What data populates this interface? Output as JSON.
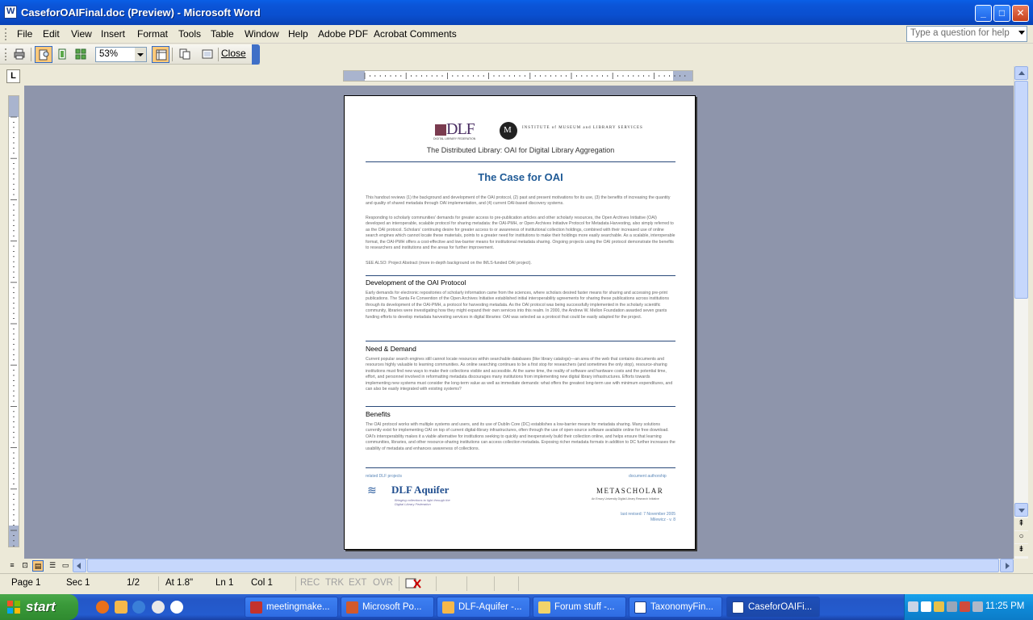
{
  "window": {
    "title": "CaseforOAIFinal.doc (Preview) - Microsoft Word"
  },
  "menu": [
    "File",
    "Edit",
    "View",
    "Insert",
    "Format",
    "Tools",
    "Table",
    "Window",
    "Help",
    "Adobe PDF",
    "Acrobat Comments"
  ],
  "help_box": {
    "placeholder": "Type a question for help"
  },
  "toolbar": {
    "zoom": "53%",
    "close_label": "Close"
  },
  "document": {
    "subtitle": "The Distributed Library: OAI for Digital Library Aggregation",
    "title": "The Case for OAI",
    "dlf_logo": "DLF",
    "dlf_logo_sub": "DIGITAL LIBRARY FEDERATION",
    "imls_logo": "INSTITUTE of MUSEUM and LIBRARY SERVICES",
    "intro1": "This handout reviews (1) the background and development of the OAI protocol, (2) past and present motivations for its use, (3) the benefits of increasing the quantity and quality of shared metadata through OAI implementation, and (4) current OAI-based discovery systems.",
    "intro2": "Responding to scholarly communities' demands for greater access to pre-publication articles and other scholarly resources, the Open Archives Initiative (OAI) developed an interoperable, scalable protocol for sharing metadata: the OAI-PMH, or Open Archives Initiative Protocol for Metadata Harvesting, also simply referred to as the OAI protocol. Scholars' continuing desire for greater access to or awareness of institutional collection holdings, combined with their increased use of online search engines which cannot locate these materials, points to a greater need for institutions to make their holdings more easily searchable. As a scalable, interoperable format, the OAI-PMH offers a cost-effective and low-barrier means for institutional metadata sharing. Ongoing projects using the OAI protocol demonstrate the benefits to researchers and institutions and the areas for further improvement.",
    "see_also": "SEE ALSO: Project Abstract (more in-depth background on the IMLS-funded OAI project).",
    "sections": [
      {
        "heading": "Development of the OAI Protocol",
        "text": "Early demands for electronic repositories of scholarly information came from the sciences, where scholars desired faster means for sharing and accessing pre-print publications. The Santa Fe Convention of the Open Archives Initiative established initial interoperability agreements for sharing these publications across institutions through its development of the OAI-PMH, a protocol for harvesting metadata. As the OAI protocol was being successfully implemented in the scholarly scientific community, libraries were investigating how they might expand their own services into this realm. In 2000, the Andrew W. Mellon Foundation awarded seven grants funding efforts to develop metadata harvesting services in digital libraries: OAI was selected as a protocol that could be easily adapted for the project."
      },
      {
        "heading": "Need & Demand",
        "text": "Current popular search engines still cannot locate resources within searchable databases (like library catalogs)—an area of the web that contains documents and resources highly valuable to learning communities. As online searching continues to be a first stop for researchers (and sometimes the only stop), resource-sharing institutions must find new ways to make their collections visible and accessible. At the same time, the reality of software and hardware costs and the potential time, effort, and personnel involved in reformatting metadata discourages many institutions from implementing new digital library infrastructures. Efforts towards implementing new systems must consider the long-term value as well as immediate demands: what offers the greatest long-term use with minimum expenditures, and can also be easily integrated with existing systems?"
      },
      {
        "heading": "Benefits",
        "text": "The OAI protocol works with multiple systems and users, and its use of Dublin Core (DC) establishes a low-barrier means for metadata sharing. Many solutions currently exist for implementing OAI on top of current digital-library infrastructures, often through the use of open-source software available online for free download. OAI's interoperability makes it a viable alternative for institutions seeking to quickly and inexpensively build their collection online, and helps ensure that learning communities, libraries, and other resource-sharing institutions can access collection metadata. Exposing richer metadata formats in addition to DC further increases the usability of metadata and enhances awareness of collections."
      }
    ],
    "footer_left": "related DLF projects",
    "footer_right": "document authorship",
    "aquifer": "DLF Aquifer",
    "aquifer_sub": "Bringing collections to light through the Digital Library Federation",
    "metascholar": "METASCHOLAR",
    "metascholar_sub": "An Emory University Digital Library Research Initiative",
    "revised": "last revised: 7 November 2005",
    "version": "Milewicz - v. 8"
  },
  "status": {
    "page": "Page 1",
    "sec": "Sec 1",
    "pages": "1/2",
    "at": "At 1.8\"",
    "ln": "Ln 1",
    "col": "Col 1",
    "rec": "REC",
    "trk": "TRK",
    "ext": "EXT",
    "ovr": "OVR"
  },
  "taskbar": {
    "start": "start",
    "tasks": [
      "meetingmake...",
      "Microsoft Po...",
      "DLF-Aquifer -...",
      "Forum stuff -...",
      "TaxonomyFin...",
      "CaseforOAIFi..."
    ],
    "clock": "11:25 PM"
  },
  "colors": {
    "title_blue": "#0a55d8",
    "heading_blue": "#1f5a96",
    "start_green": "#3a9a3a",
    "doc_bg": "#8e95ab"
  }
}
